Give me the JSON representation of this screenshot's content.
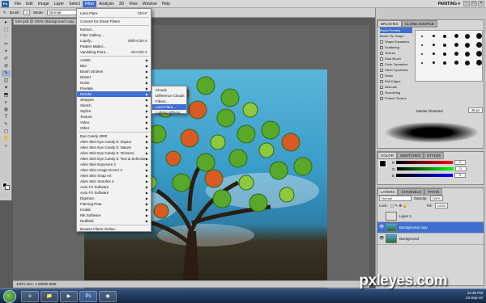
{
  "menubar": {
    "logo": "Ps",
    "items": [
      "File",
      "Edit",
      "Image",
      "Layer",
      "Select",
      "Filter",
      "Analysis",
      "3D",
      "View",
      "Window",
      "Help"
    ],
    "active_index": 5,
    "workspace": "PAINTING ▾",
    "win_min": "–",
    "win_max": "□",
    "win_close": "×"
  },
  "options": {
    "brush_label": "Brush:",
    "brush_size": "1",
    "mode_label": "Mode:",
    "mode_value": "Normal"
  },
  "document": {
    "tab_title": "tree.psd @ 100% (Background copy, RGB/8) *",
    "status": "100%     Doc: 1.00M/6.85M"
  },
  "tools": [
    "▸",
    "⬚",
    "◌",
    "✂",
    "⌖",
    "✐",
    "⊘",
    "✎",
    "◫",
    "✦",
    "⬒",
    "◐",
    "◍",
    "T",
    "↖",
    "◻",
    "✋",
    "⌕"
  ],
  "filter_menu": {
    "items": [
      {
        "label": "Lens Flare",
        "shortcut": "Ctrl+F",
        "sub": false
      },
      {
        "label": "Convert for Smart Filters",
        "shortcut": "",
        "sub": false
      },
      {
        "label": "Extract...",
        "shortcut": "",
        "sub": false
      },
      {
        "label": "Filter Gallery...",
        "shortcut": "",
        "sub": false
      },
      {
        "label": "Liquify...",
        "shortcut": "Shift+Ctrl+X",
        "sub": false
      },
      {
        "label": "Pattern Maker...",
        "shortcut": "",
        "sub": false
      },
      {
        "label": "Vanishing Point...",
        "shortcut": "Alt+Ctrl+V",
        "sub": false
      },
      {
        "label": "Artistic",
        "shortcut": "",
        "sub": true
      },
      {
        "label": "Blur",
        "shortcut": "",
        "sub": true
      },
      {
        "label": "Brush Strokes",
        "shortcut": "",
        "sub": true
      },
      {
        "label": "Distort",
        "shortcut": "",
        "sub": true
      },
      {
        "label": "Noise",
        "shortcut": "",
        "sub": true
      },
      {
        "label": "Pixelate",
        "shortcut": "",
        "sub": true
      },
      {
        "label": "Render",
        "shortcut": "",
        "sub": true
      },
      {
        "label": "Sharpen",
        "shortcut": "",
        "sub": true
      },
      {
        "label": "Sketch",
        "shortcut": "",
        "sub": true
      },
      {
        "label": "Stylize",
        "shortcut": "",
        "sub": true
      },
      {
        "label": "Texture",
        "shortcut": "",
        "sub": true
      },
      {
        "label": "Video",
        "shortcut": "",
        "sub": true
      },
      {
        "label": "Other",
        "shortcut": "",
        "sub": true
      },
      {
        "label": "Eye Candy 4000",
        "shortcut": "",
        "sub": true
      },
      {
        "label": "Alien Skin Eye Candy 5: Impact",
        "shortcut": "",
        "sub": true
      },
      {
        "label": "Alien Skin Eye Candy 5: Nature",
        "shortcut": "",
        "sub": true
      },
      {
        "label": "Alien Skin Eye Candy 5: Textures",
        "shortcut": "",
        "sub": true
      },
      {
        "label": "Alien Skin Eye Candy 6: Text & Selection",
        "shortcut": "",
        "sub": true
      },
      {
        "label": "Alien Skin Exposure 2",
        "shortcut": "",
        "sub": true
      },
      {
        "label": "Alien Skin Image Doctor 2",
        "shortcut": "",
        "sub": true
      },
      {
        "label": "Alien Skin Snap Art",
        "shortcut": "",
        "sub": true
      },
      {
        "label": "Alien Skin Xenofex 2",
        "shortcut": "",
        "sub": true
      },
      {
        "label": "Auto FX Software",
        "shortcut": "",
        "sub": true
      },
      {
        "label": "Auto FX Software",
        "shortcut": "",
        "sub": true
      },
      {
        "label": "Digimarc",
        "shortcut": "",
        "sub": true
      },
      {
        "label": "Flaming Pear",
        "shortcut": "",
        "sub": true
      },
      {
        "label": "Kodak",
        "shortcut": "",
        "sub": true
      },
      {
        "label": "Nik Software",
        "shortcut": "",
        "sub": true
      },
      {
        "label": "Redfield",
        "shortcut": "",
        "sub": true
      },
      {
        "label": "Browse Filters Online...",
        "shortcut": "",
        "sub": false
      }
    ],
    "highlight_index": 13
  },
  "render_submenu": {
    "items": [
      "Clouds",
      "Difference Clouds",
      "Fibers...",
      "Lens Flare...",
      "Lighting Effects..."
    ],
    "highlight_index": 3
  },
  "brushes_panel": {
    "tabs": [
      "BRUSHES",
      "CLONE SOURCE"
    ],
    "options": [
      "Brush Presets",
      "Brush Tip Shape",
      "Shape Dynamics",
      "Scattering",
      "Texture",
      "Dual Brush",
      "Color Dynamics",
      "Other Dynamics",
      "Noise",
      "Wet Edges",
      "Airbrush",
      "Smoothing",
      "Protect Texture"
    ],
    "selected_index": 0,
    "master_label": "Master Diameter",
    "master_value": "48 px"
  },
  "color_panel": {
    "tabs": [
      "COLOR",
      "SWATCHES",
      "STYLES"
    ],
    "rows": [
      {
        "label": "R",
        "value": "0"
      },
      {
        "label": "G",
        "value": "0"
      },
      {
        "label": "B",
        "value": "0"
      }
    ]
  },
  "layers_panel": {
    "tabs": [
      "LAYERS",
      "CHANNELS",
      "PATHS"
    ],
    "blend_mode": "Normal",
    "opacity_label": "Opacity:",
    "opacity": "100%",
    "lock_label": "Lock:",
    "fill_label": "Fill:",
    "fill": "100%",
    "layers": [
      {
        "name": "Layer 1",
        "selected": false,
        "visible": false
      },
      {
        "name": "Background copy",
        "selected": true,
        "visible": true
      },
      {
        "name": "Background",
        "selected": false,
        "visible": true
      }
    ]
  },
  "taskbar": {
    "icons": [
      "e",
      "📁",
      "▶",
      "Ps",
      "◉"
    ],
    "time": "12:45 PM",
    "date": "23-Sep-10"
  },
  "watermark": "pxleyes.com",
  "colors": {
    "accent": "#3f6fd1",
    "menu_bg": "#f2f2f2",
    "panel_bg": "#c8c8c8"
  }
}
